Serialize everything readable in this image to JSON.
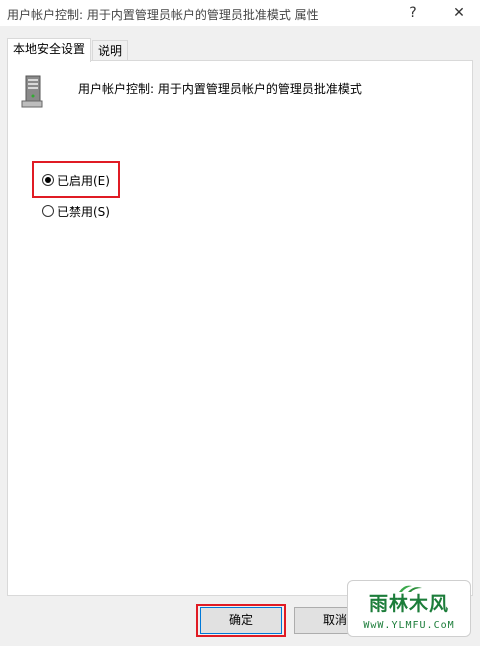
{
  "window": {
    "title": "用户帐户控制: 用于内置管理员帐户的管理员批准模式 属性",
    "help_glyph": "?",
    "close_glyph": "✕"
  },
  "tabs": [
    {
      "label": "本地安全设置",
      "active": true
    },
    {
      "label": "说明",
      "active": false
    }
  ],
  "policy": {
    "icon": "server-icon",
    "title": "用户帐户控制: 用于内置管理员帐户的管理员批准模式"
  },
  "options": [
    {
      "label": "已启用(E)",
      "checked": true,
      "highlighted": true
    },
    {
      "label": "已禁用(S)",
      "checked": false,
      "highlighted": false
    }
  ],
  "buttons": {
    "ok": "确定",
    "cancel": "取消"
  },
  "watermark": {
    "top": "雨林木风",
    "bottom": "WwW.YLMFU.CoM"
  },
  "colors": {
    "highlight": "#e01b24",
    "watermark": "#1c7d3a"
  }
}
